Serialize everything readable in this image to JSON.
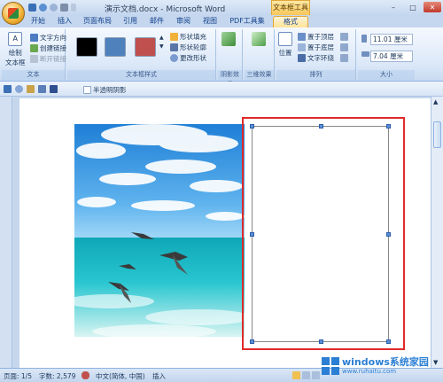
{
  "window": {
    "title": "演示文档.docx - Microsoft Word",
    "context_tool": "文本框工具"
  },
  "tabs": [
    {
      "label": "开始"
    },
    {
      "label": "插入"
    },
    {
      "label": "页面布局"
    },
    {
      "label": "引用"
    },
    {
      "label": "邮件"
    },
    {
      "label": "审阅"
    },
    {
      "label": "视图"
    },
    {
      "label": "PDF工具集"
    },
    {
      "label": "格式"
    }
  ],
  "ribbon": {
    "text_group": {
      "label": "文本",
      "draw_textbox_line1": "绘制",
      "draw_textbox_line2": "文本框",
      "text_direction": "文字方向",
      "create_link": "创建链接",
      "break_link": "断开链接"
    },
    "styles_group": {
      "label": "文本框样式",
      "shape_fill": "形状填充",
      "shape_outline": "形状轮廓",
      "change_shape": "更改形状",
      "swatch_colors": [
        "#000000",
        "#4f81bd",
        "#c0504d"
      ]
    },
    "shadow_group": {
      "label": "阴影效果"
    },
    "threed_group": {
      "label": "三维效果"
    },
    "arrange_group": {
      "label": "排列",
      "position": "位置",
      "bring_front": "置于顶层",
      "send_back": "置于底层",
      "text_wrap": "文字环绕"
    },
    "size_group": {
      "label": "大小",
      "height": "11.01 厘米",
      "width": "7.04 厘米"
    }
  },
  "drawbar": {
    "semi_transparent_shadow": "半透明阴影"
  },
  "statusbar": {
    "page": "页面: 1/5",
    "words": "字数: 2,579",
    "language": "中文(简体, 中国)",
    "mode": "插入"
  },
  "watermark": {
    "line1": "windows系统家园",
    "line2": "www.ruhaitu.com"
  }
}
